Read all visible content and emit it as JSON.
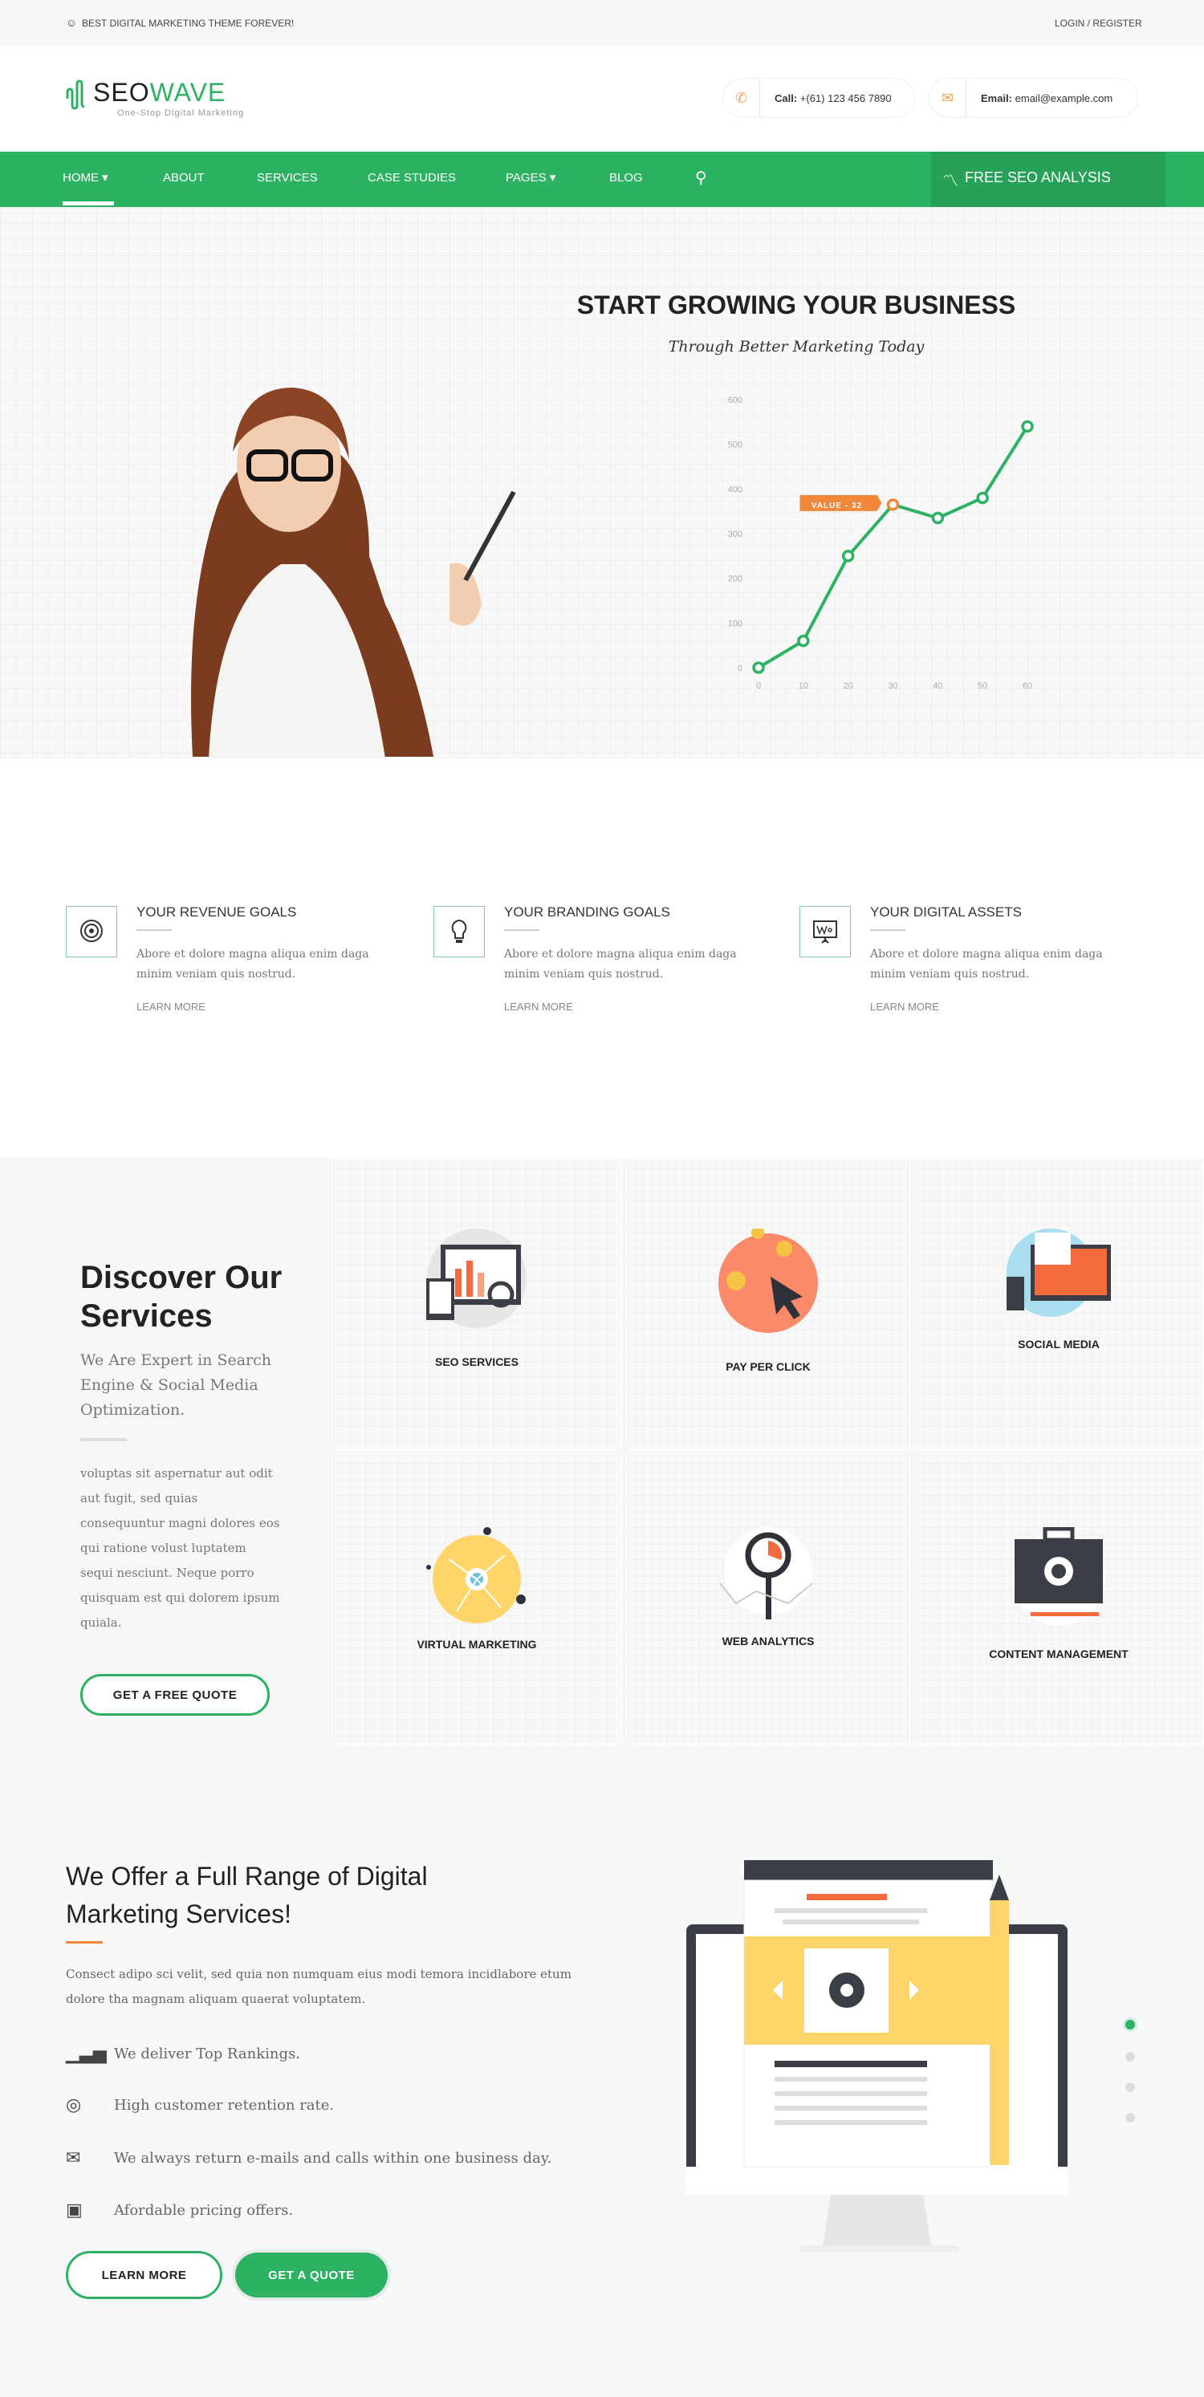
{
  "topbar": {
    "tagline": "BEST DIGITAL MARKETING THEME FOREVER!",
    "login": "LOGIN / REGISTER",
    "tagline_icon": "smiley-icon"
  },
  "header": {
    "logo_seo": "SEO",
    "logo_wave": "WAVE",
    "logo_tagline": "One-Stop Digital Marketing",
    "call_label": "Call:",
    "call_value": "+(61) 123 456 7890",
    "email_label": "Email:",
    "email_value": "email@example.com"
  },
  "nav": {
    "items": [
      {
        "label": "HOME ▾"
      },
      {
        "label": "ABOUT"
      },
      {
        "label": "SERVICES"
      },
      {
        "label": "CASE STUDIES"
      },
      {
        "label": "PAGES ▾"
      },
      {
        "label": "BLOG"
      }
    ],
    "cta": "FREE SEO ANALYSIS"
  },
  "colors": {
    "brand": "#2db163",
    "accent": "#f0873a",
    "dark": "#222222"
  },
  "hero": {
    "title": "START GROWING YOUR BUSINESS",
    "subtitle": "Through Better Marketing Today"
  },
  "chart_data": {
    "type": "line",
    "x": [
      0,
      10,
      20,
      30,
      40,
      50,
      60
    ],
    "values": [
      0,
      60,
      250,
      365,
      335,
      380,
      540
    ],
    "xlim": [
      0,
      60
    ],
    "ylim": [
      0,
      600
    ],
    "xticks": [
      "0",
      "10",
      "20",
      "30",
      "40",
      "50",
      "60"
    ],
    "yticks": [
      "0",
      "100",
      "200",
      "300",
      "400",
      "500",
      "600"
    ],
    "annotation": "VALUE - 32",
    "grid": false
  },
  "features": [
    {
      "title": "YOUR REVENUE GOALS",
      "text": "Abore et dolore magna aliqua enim daga minim veniam quis nostrud.",
      "link": "LEARN MORE",
      "icon": "target-icon"
    },
    {
      "title": "YOUR BRANDING GOALS",
      "text": "Abore et dolore magna aliqua enim daga minim veniam quis nostrud.",
      "link": "LEARN MORE",
      "icon": "lightbulb-icon"
    },
    {
      "title": "YOUR DIGITAL ASSETS",
      "text": "Abore et dolore magna aliqua enim daga minim veniam quis nostrud.",
      "link": "LEARN MORE",
      "icon": "presentation-board-icon"
    }
  ],
  "services": {
    "title": "Discover Our Services",
    "subtitle": "We Are Expert in Search Engine & Social Media Optimization.",
    "text": "voluptas sit aspernatur aut odit aut fugit, sed quias consequuntur magni dolores eos qui ratione volust luptatem sequi nesciunt. Neque porro quisquam est qui dolorem ipsum quiala.",
    "button": "GET A FREE QUOTE",
    "cards": [
      {
        "label": "SEO SERVICES"
      },
      {
        "label": "PAY PER CLICK"
      },
      {
        "label": "SOCIAL MEDIA"
      },
      {
        "label": "VIRTUAL MARKETING"
      },
      {
        "label": "WEB ANALYTICS"
      },
      {
        "label": "CONTENT MANAGEMENT"
      }
    ]
  },
  "offer": {
    "title": "We Offer a Full Range of Digital Marketing Services!",
    "text": "Consect adipo sci velit, sed quia non numquam eius modi temora incidlabore etum dolore tha magnam aliquam quaerat voluptatem.",
    "list": [
      {
        "text": "We deliver Top Rankings.",
        "icon": "bar-chart-icon"
      },
      {
        "text": "High customer retention rate.",
        "icon": "user-circle-icon"
      },
      {
        "text": "We always return e-mails and calls within one business day.",
        "icon": "open-envelope-icon"
      },
      {
        "text": "Afordable pricing offers.",
        "icon": "money-icon"
      }
    ],
    "learn_more": "LEARN MORE",
    "quote": "GET A QUOTE"
  }
}
